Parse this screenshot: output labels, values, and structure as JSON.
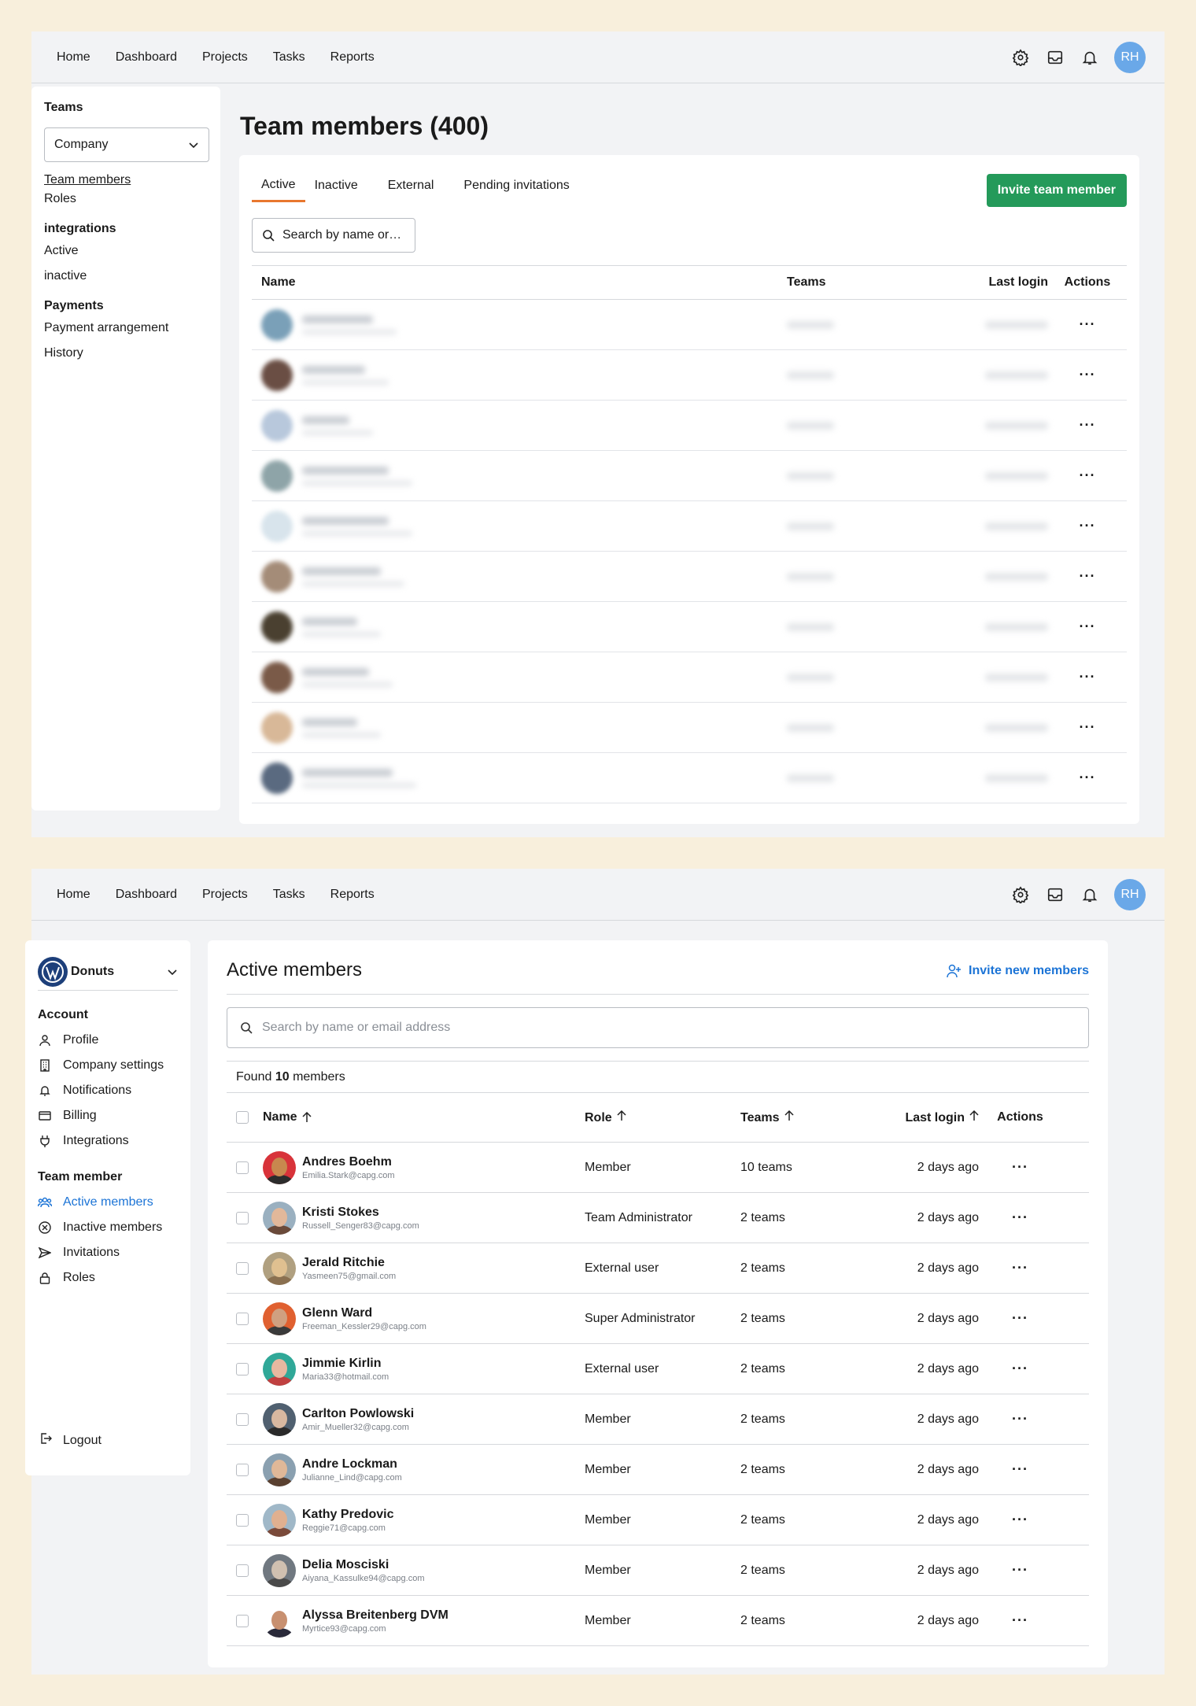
{
  "nav": {
    "links": [
      "Home",
      "Dashboard",
      "Projects",
      "Tasks",
      "Reports"
    ],
    "avatar_initials": "RH"
  },
  "screen1": {
    "sidebar": {
      "teams_heading": "Teams",
      "company_select": "Company",
      "links_a": [
        "Team members",
        "Roles"
      ],
      "integrations_heading": "integrations",
      "links_b": [
        "Active",
        "inactive"
      ],
      "payments_heading": "Payments",
      "links_c": [
        "Payment arrangement",
        "History"
      ]
    },
    "title": "Team members (400)",
    "tabs": [
      "Active",
      "Inactive",
      "External",
      "Pending invitations"
    ],
    "invite_button": "Invite team member",
    "search_placeholder": "Search by name or…",
    "columns": {
      "name": "Name",
      "teams": "Teams",
      "last_login": "Last login",
      "actions": "Actions"
    },
    "row_count": 10,
    "actions_glyph": "···"
  },
  "screen2": {
    "sidebar": {
      "brand": "Donuts",
      "account_heading": "Account",
      "account_items": [
        {
          "label": "Profile",
          "icon": "user-icon"
        },
        {
          "label": "Company settings",
          "icon": "building-icon"
        },
        {
          "label": "Notifications",
          "icon": "bell-icon"
        },
        {
          "label": "Billing",
          "icon": "credit-card-icon"
        },
        {
          "label": "Integrations",
          "icon": "plug-icon"
        }
      ],
      "member_heading": "Team member",
      "member_items": [
        {
          "label": "Active members",
          "icon": "users-icon"
        },
        {
          "label": "Inactive members",
          "icon": "circle-x-icon"
        },
        {
          "label": "Invitations",
          "icon": "send-icon"
        },
        {
          "label": "Roles",
          "icon": "lock-icon"
        }
      ],
      "logout": "Logout"
    },
    "title": "Active members",
    "invite_link": "Invite new members",
    "search_placeholder": "Search by name or email address",
    "found_prefix": "Found",
    "found_count": "10",
    "found_suffix": "members",
    "columns": {
      "name": "Name",
      "role": "Role",
      "teams": "Teams",
      "last_login": "Last login",
      "actions": "Actions"
    },
    "members": [
      {
        "name": "Andres Boehm",
        "email": "Emilia.Stark@capg.com",
        "role": "Member",
        "teams": "10 teams",
        "last_login": "2 days ago"
      },
      {
        "name": "Kristi Stokes",
        "email": "Russell_Senger83@capg.com",
        "role": "Team Administrator",
        "teams": "2 teams",
        "last_login": "2 days ago"
      },
      {
        "name": "Jerald Ritchie",
        "email": "Yasmeen75@gmail.com",
        "role": "External user",
        "teams": "2 teams",
        "last_login": "2 days ago"
      },
      {
        "name": "Glenn Ward",
        "email": "Freeman_Kessler29@capg.com",
        "role": "Super Administrator",
        "teams": "2 teams",
        "last_login": "2 days ago"
      },
      {
        "name": "Jimmie Kirlin",
        "email": "Maria33@hotmail.com",
        "role": "External user",
        "teams": "2 teams",
        "last_login": "2 days ago"
      },
      {
        "name": "Carlton Powlowski",
        "email": "Amir_Mueller32@capg.com",
        "role": "Member",
        "teams": "2 teams",
        "last_login": "2 days ago"
      },
      {
        "name": "Andre Lockman",
        "email": "Julianne_Lind@capg.com",
        "role": "Member",
        "teams": "2 teams",
        "last_login": "2 days ago"
      },
      {
        "name": "Kathy Predovic",
        "email": "Reggie71@capg.com",
        "role": "Member",
        "teams": "2 teams",
        "last_login": "2 days ago"
      },
      {
        "name": "Delia Mosciski",
        "email": "Aiyana_Kassulke94@capg.com",
        "role": "Member",
        "teams": "2 teams",
        "last_login": "2 days ago"
      },
      {
        "name": "Alyssa Breitenberg DVM",
        "email": "Myrtice93@capg.com",
        "role": "Member",
        "teams": "2 teams",
        "last_login": "2 days ago"
      }
    ]
  },
  "colors": {
    "accent_orange": "#e8772e",
    "invite_green": "#249a5a",
    "link_blue": "#1c74d6",
    "avatar_blue": "#6aa8e8"
  }
}
